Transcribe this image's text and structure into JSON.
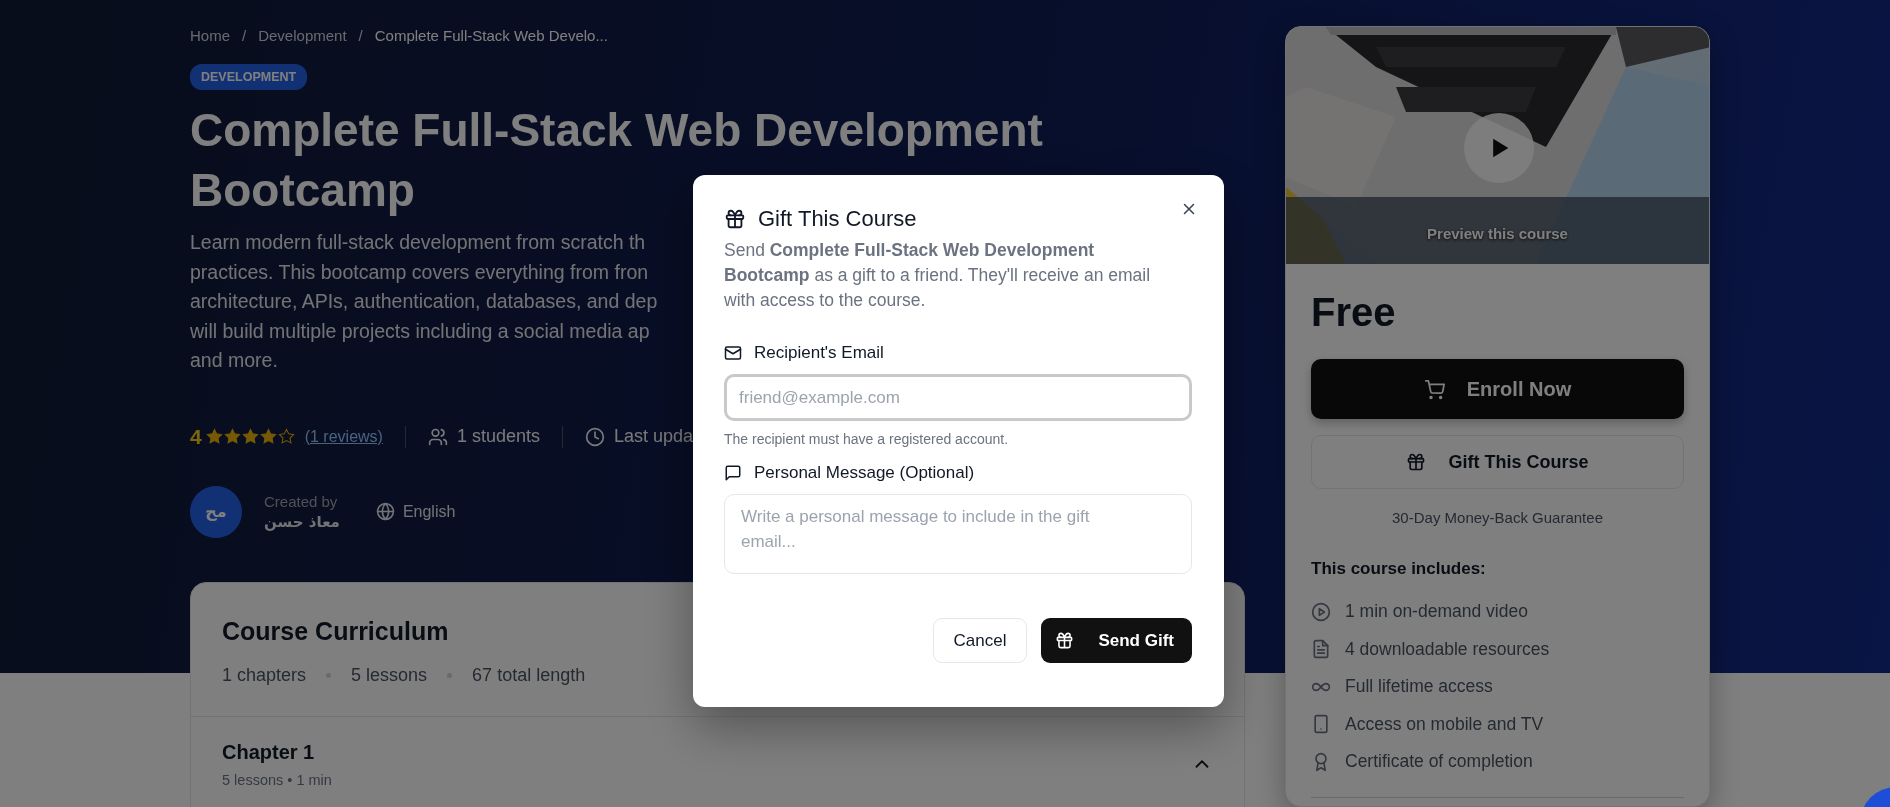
{
  "breadcrumb": [
    {
      "label": "Home"
    },
    {
      "label": "Development"
    },
    {
      "label": "Complete Full-Stack Web Develo..."
    }
  ],
  "category_badge": "DEVELOPMENT",
  "breadcrumb_separator": "/",
  "title_lines": [
    "Complete Full-Stack Web Development",
    "Bootcamp"
  ],
  "description_lines": [
    "Learn modern full-stack development from scratch th",
    "practices. This bootcamp covers everything from fron",
    "architecture, APIs, authentication, databases, and dep",
    "will build multiple projects including a social media ap",
    "and more."
  ],
  "meta": {
    "rating": "4",
    "stars": 4,
    "reviews": "(1 reviews)",
    "students": "1 students",
    "updated": "Last upda"
  },
  "author": {
    "initials": "مح",
    "created_by": "Created by",
    "name": "معاذ حسن",
    "language": "English"
  },
  "curriculum": {
    "title": "Course Curriculum",
    "stats": [
      "1 chapters",
      "5 lessons",
      "67 total length"
    ],
    "chapters": [
      {
        "title": "Chapter 1",
        "meta": "5 lessons • 1 min",
        "expanded": true
      }
    ]
  },
  "course_card": {
    "preview_label": "Preview this course",
    "price": "Free",
    "enroll_button": "Enroll Now",
    "gift_button": "Gift This Course",
    "guarantee": "30-Day Money-Back Guarantee",
    "includes_title": "This course includes:",
    "includes": [
      {
        "kind": "video",
        "text": "1 min on-demand video"
      },
      {
        "kind": "file",
        "text": "4 downloadable resources"
      },
      {
        "kind": "infinity",
        "text": "Full lifetime access"
      },
      {
        "kind": "mobile",
        "text": "Access on mobile and TV"
      },
      {
        "kind": "award",
        "text": "Certificate of completion"
      }
    ]
  },
  "gift_modal": {
    "title": "Gift This Course",
    "description": "Send **Complete Full-Stack Web Development Bootcamp** as a gift to a friend. They'll receive an email with access to the course.",
    "email": {
      "label": "Recipient's Email",
      "placeholder": "friend@example.com",
      "focused": true,
      "hint": "The recipient must have a registered account."
    },
    "message": {
      "label": "Personal Message (Optional)",
      "placeholder": "Write a personal message to include in the gift email..."
    },
    "cancel_button": "Cancel",
    "send_button": "Send Gift"
  }
}
